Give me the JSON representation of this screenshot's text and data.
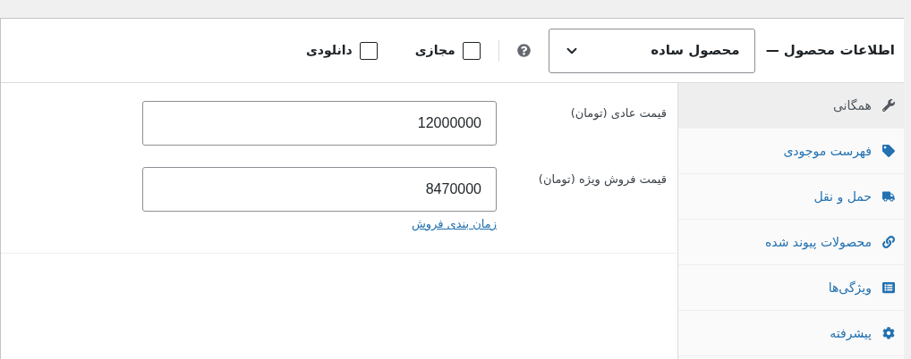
{
  "header": {
    "title": "اطلاعات محصول —",
    "product_type": "محصول ساده",
    "options": [
      {
        "label": "مجازی",
        "checked": false
      },
      {
        "label": "دانلودی",
        "checked": false
      }
    ]
  },
  "tabs": [
    {
      "label": "همگانی",
      "selected": true,
      "kind": "wrench"
    },
    {
      "label": "فهرست موجودی",
      "selected": false,
      "kind": "tag"
    },
    {
      "label": "حمل و نقل",
      "selected": false,
      "kind": "truck"
    },
    {
      "label": "محصولات پیوند شده",
      "selected": false,
      "kind": "link"
    },
    {
      "label": "ویژگی‌ها",
      "selected": false,
      "kind": "list"
    },
    {
      "label": "پیشرفته",
      "selected": false,
      "kind": "gear"
    }
  ],
  "fields": [
    {
      "label": "قیمت عادی (تومان)",
      "value": "12000000"
    },
    {
      "label": "قیمت فروش ویژه (تومان)",
      "value": "8470000"
    }
  ],
  "schedule_link": "زمان بندی فروش"
}
